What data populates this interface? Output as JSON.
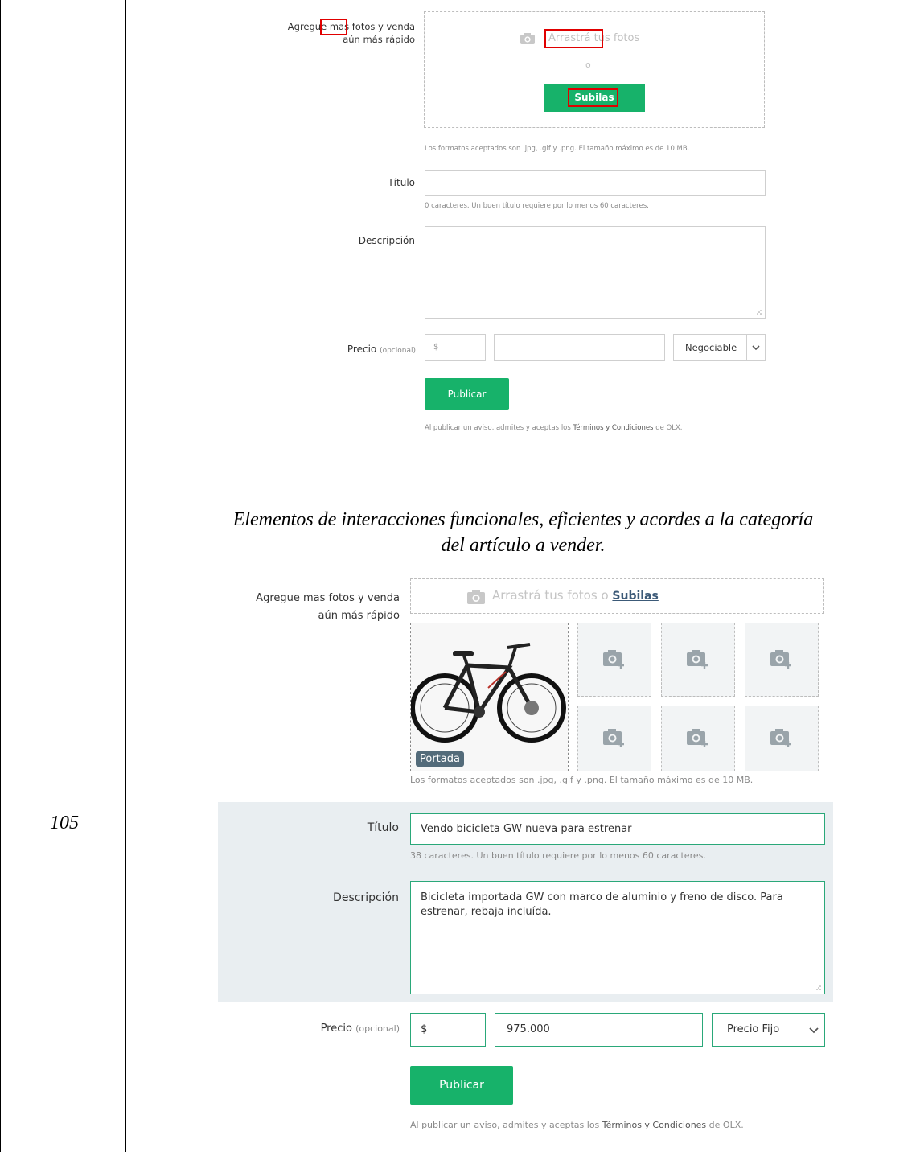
{
  "top": {
    "photos_label_a": "Agregue",
    "photos_label_mas": "mas",
    "photos_label_b": "fotos y venda",
    "photos_label_line2": "aún más rápido",
    "drag_word": "Arrastrá",
    "drag_rest": "tus fotos",
    "or_text": "o",
    "upload_button": "Subilas",
    "formats_hint": "Los formatos aceptados son .jpg, .gif y .png. El tamaño máximo es de 10 MB.",
    "title_label": "Título",
    "title_value": "",
    "title_hint": "0 caracteres. Un buen título requiere por lo menos 60 caracteres.",
    "description_label": "Descripción",
    "description_value": "",
    "price_label": "Precio",
    "price_optional": "(opcional)",
    "currency": "$",
    "price_value": "",
    "negotiable_select": "Negociable",
    "publish_button": "Publicar",
    "terms_pre": "Al publicar un aviso, admites y aceptas los ",
    "terms_link": "Términos y Condiciones",
    "terms_post": " de OLX."
  },
  "row_number": "105",
  "caption_line1": "Elementos de interacciones funcionales, eficientes y acordes a la categoría",
  "caption_line2": "del artículo a vender.",
  "bottom": {
    "photos_label_line1": "Agregue mas fotos y venda",
    "photos_label_line2": "aún más rápido",
    "drag_text": "Arrastrá tus fotos",
    "or_text": "o",
    "upload_link": "Subilas",
    "cover_badge": "Portada",
    "formats_hint": "Los formatos aceptados son .jpg, .gif y .png. El tamaño máximo es de 10 MB.",
    "title_label": "Título",
    "title_value": "Vendo bicicleta GW nueva para estrenar",
    "title_hint": "38 caracteres. Un buen título requiere por lo menos 60 caracteres.",
    "description_label": "Descripción",
    "description_value": "Bicicleta importada GW con marco de aluminio y freno de disco. Para estrenar, rebaja incluída.",
    "price_label": "Precio",
    "price_optional": "(opcional)",
    "currency": "$",
    "price_value": "975.000",
    "price_type_select": "Precio Fijo",
    "publish_button": "Publicar",
    "terms_pre": "Al publicar un aviso, admites y aceptas los ",
    "terms_link": "Términos y Condiciones",
    "terms_post": " de OLX."
  },
  "colors": {
    "accent_green": "#17b26a",
    "highlight_red": "#e00000",
    "focus_green": "#2aa879",
    "section_bg": "#e9eef1"
  },
  "icons": [
    "camera-icon",
    "camera-plus-icon",
    "chevron-down-icon",
    "resize-grip-icon"
  ]
}
